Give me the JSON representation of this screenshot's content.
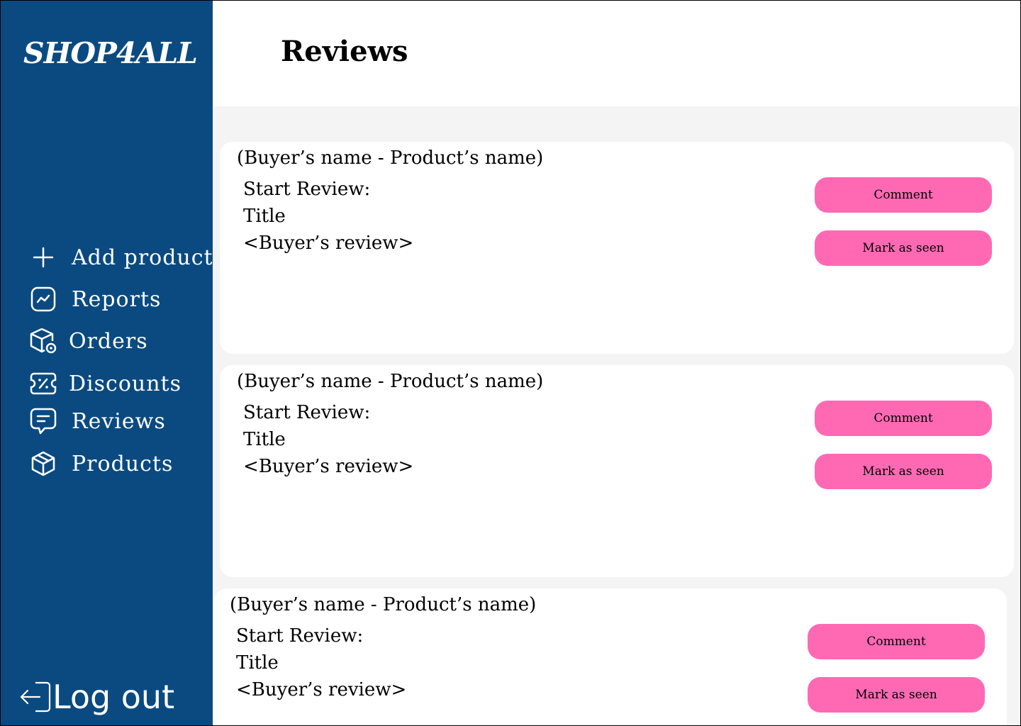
{
  "app": {
    "logo": "SHOP4ALL"
  },
  "header": {
    "title": "Reviews"
  },
  "sidebar": {
    "items": [
      {
        "label": "Add product",
        "icon": "plus-icon"
      },
      {
        "label": "Reports",
        "icon": "chart-icon"
      },
      {
        "label": "Orders",
        "icon": "box-icon"
      },
      {
        "label": "Discounts",
        "icon": "discount-ticket-icon"
      },
      {
        "label": "Reviews",
        "icon": "message-icon"
      },
      {
        "label": "Products",
        "icon": "package-icon"
      }
    ],
    "logout": {
      "label": "Log out",
      "icon": "logout-icon"
    }
  },
  "reviews": [
    {
      "meta": "(Buyer’s name - Product’s name)",
      "start": "Start Review:",
      "title": "Title",
      "body": "<Buyer’s review>",
      "comment_label": "Comment",
      "seen_label": "Mark as seen"
    },
    {
      "meta": "(Buyer’s name - Product’s name)",
      "start": "Start Review:",
      "title": "Title",
      "body": "<Buyer’s review>",
      "comment_label": "Comment",
      "seen_label": "Mark as seen"
    },
    {
      "meta": "(Buyer’s name - Product’s name)",
      "start": "Start Review:",
      "title": "Title",
      "body": "<Buyer’s review>",
      "comment_label": "Comment",
      "seen_label": "Mark as seen"
    }
  ],
  "colors": {
    "sidebar": "#0a4a80",
    "button": "#ff69b4",
    "content_bg": "#f4f4f4"
  }
}
